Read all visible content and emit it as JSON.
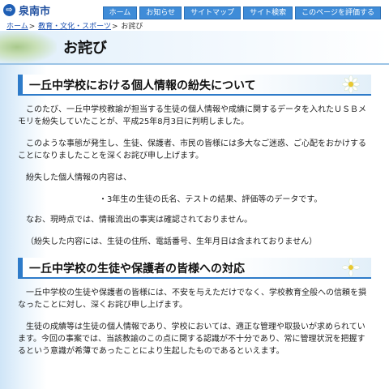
{
  "site": {
    "name": "泉南市"
  },
  "nav": [
    "ホーム",
    "お知らせ",
    "サイトマップ",
    "サイト検索",
    "このページを評価する"
  ],
  "breadcrumb": {
    "items": [
      "ホーム",
      "教育・文化・スポーツ"
    ],
    "current": "お詫び",
    "separator": ">"
  },
  "page_title": "お詫び",
  "sections": [
    {
      "heading": "一丘中学校における個人情報の紛失について",
      "paragraphs": [
        "このたび、一丘中学校教諭が担当する生徒の個人情報や成績に関するデータを入れたＵＳＢメモリを紛失していたことが、平成25年8月3日に判明しました。",
        "このような事態が発生し、生徒、保護者、市民の皆様には多大なご迷惑、ご心配をおかけすることになりましたことを深くお詫び申し上げます。",
        "紛失した個人情報の内容は、"
      ],
      "list_item": "・3年生の生徒の氏名、テストの結果、評価等のデータです。",
      "after": [
        "なお、現時点では、情報流出の事実は確認されておりません。",
        "（紛失した内容には、生徒の住所、電話番号、生年月日は含まれておりません）"
      ]
    },
    {
      "heading": "一丘中学校の生徒や保護者の皆様への対応",
      "paragraphs": [
        "一丘中学校の生徒や保護者の皆様には、不安を与えただけでなく、学校教育全般への信頼を損なったことに対し、深くお詫び申し上げます。",
        "生徒の成績等は生徒の個人情報であり、学校においては、適正な管理や取扱いが求められています。今回の事案では、当該教諭のこの点に関する認識が不十分であり、常に管理状況を把握するという意識が希薄であったことにより生起したものであるといえます。"
      ]
    }
  ],
  "colors": {
    "accent": "#2e7bc9",
    "nav_button": "#3f8cd8",
    "link": "#1a4fb0"
  }
}
